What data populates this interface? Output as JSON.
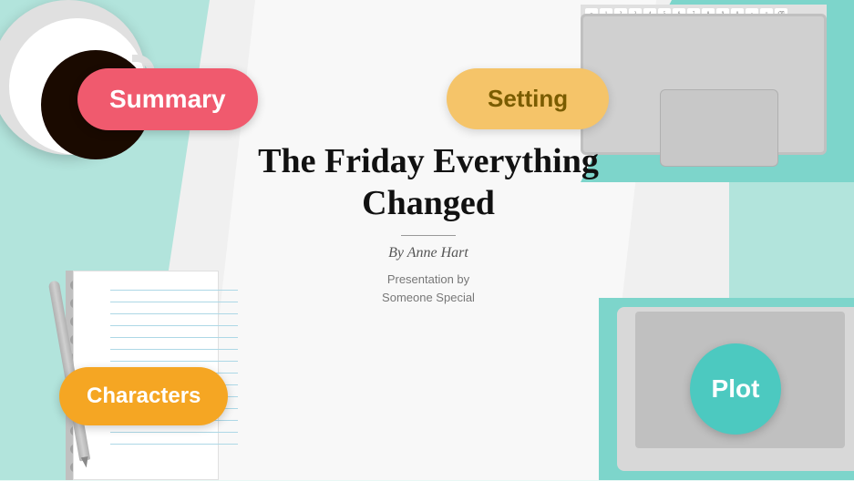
{
  "background": {
    "main_color": "#b2e4dc",
    "teal_color": "#7dd5cb",
    "white_color": "#f8f8f8"
  },
  "badges": {
    "summary": {
      "label": "Summary",
      "bg_color": "#f05a6e",
      "text_color": "#ffffff"
    },
    "setting": {
      "label": "Setting",
      "bg_color": "#f5c469",
      "text_color": "#7a5c00"
    },
    "characters": {
      "label": "Characters",
      "bg_color": "#f5a623",
      "text_color": "#ffffff"
    },
    "plot": {
      "label": "Plot",
      "bg_color": "#4cc9c0",
      "text_color": "#ffffff"
    }
  },
  "title": {
    "main": "The Friday Everything Changed",
    "author_prefix": "By Anne Hart",
    "presentation_line1": "Presentation by",
    "presentation_line2": "Someone Special"
  }
}
